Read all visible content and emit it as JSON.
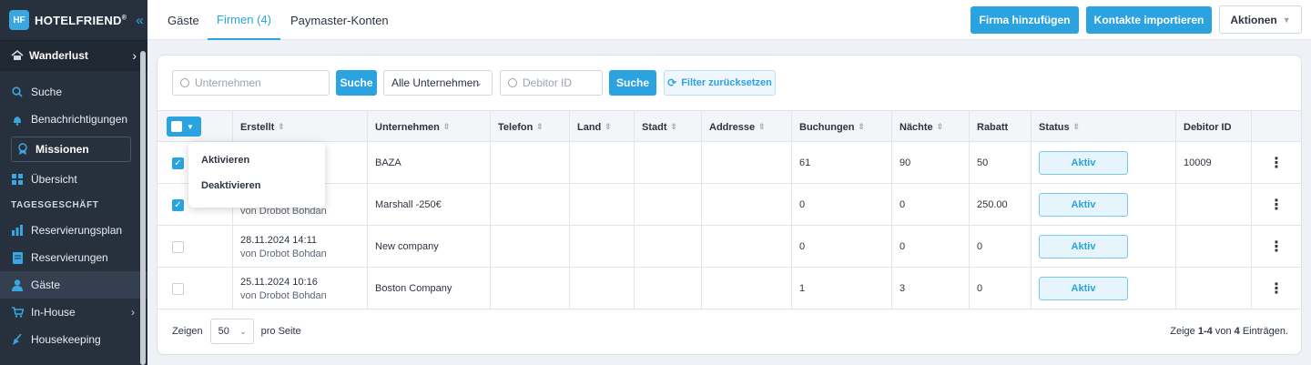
{
  "brand": {
    "name": "HOTELFRIEND",
    "reg": "®",
    "logo_text": "HF"
  },
  "sidebar": {
    "hotel": "Wanderlust",
    "search": "Suche",
    "notifications": "Benachrichtigungen",
    "missions": "Missionen",
    "overview": "Übersicht",
    "section": "TAGESGESCHÄFT",
    "items": [
      {
        "label": "Reservierungsplan"
      },
      {
        "label": "Reservierungen"
      },
      {
        "label": "Gäste"
      },
      {
        "label": "In-House"
      },
      {
        "label": "Housekeeping"
      }
    ]
  },
  "tabs": [
    {
      "label": "Gäste"
    },
    {
      "label": "Firmen (4)"
    },
    {
      "label": "Paymaster-Konten"
    }
  ],
  "header_buttons": {
    "add": "Firma hinzufügen",
    "import": "Kontakte importieren",
    "actions": "Aktionen"
  },
  "filters": {
    "company_placeholder": "Unternehmen",
    "search_label": "Suche",
    "select_value": "Alle Unternehmen",
    "debitor_placeholder": "Debitor ID",
    "search_label2": "Suche",
    "reset_label": "Filter zurücksetzen"
  },
  "table": {
    "headers": [
      "Erstellt",
      "Unternehmen",
      "Telefon",
      "Land",
      "Stadt",
      "Addresse",
      "Buchungen",
      "Nächte",
      "Rabatt",
      "Status",
      "Debitor ID"
    ],
    "rows": [
      {
        "checked": true,
        "date": "",
        "by": "",
        "company": "BAZA",
        "bookings": "61",
        "nights": "90",
        "discount": "50",
        "status": "Aktiv",
        "debitor": "10009"
      },
      {
        "checked": true,
        "date": "",
        "by": "von Drobot Bohdan",
        "company": "Marshall -250€",
        "bookings": "0",
        "nights": "0",
        "discount": "250.00",
        "status": "Aktiv",
        "debitor": ""
      },
      {
        "checked": false,
        "date": "28.11.2024 14:11",
        "by": "von Drobot Bohdan",
        "company": "New company",
        "bookings": "0",
        "nights": "0",
        "discount": "0",
        "status": "Aktiv",
        "debitor": ""
      },
      {
        "checked": false,
        "date": "25.11.2024 10:16",
        "by": "von Drobot Bohdan",
        "company": "Boston Company",
        "bookings": "1",
        "nights": "3",
        "discount": "0",
        "status": "Aktiv",
        "debitor": ""
      }
    ]
  },
  "dropdown": {
    "activate": "Aktivieren",
    "deactivate": "Deaktivieren"
  },
  "footer": {
    "show": "Zeigen",
    "per_page_value": "50",
    "per_page_label": "pro Seite",
    "summary_prefix": "Zeige",
    "range": "1-4",
    "of": "von",
    "total": "4",
    "suffix": "Einträgen."
  },
  "colors": {
    "accent": "#2aa3e0",
    "sidebar": "#27313d"
  }
}
